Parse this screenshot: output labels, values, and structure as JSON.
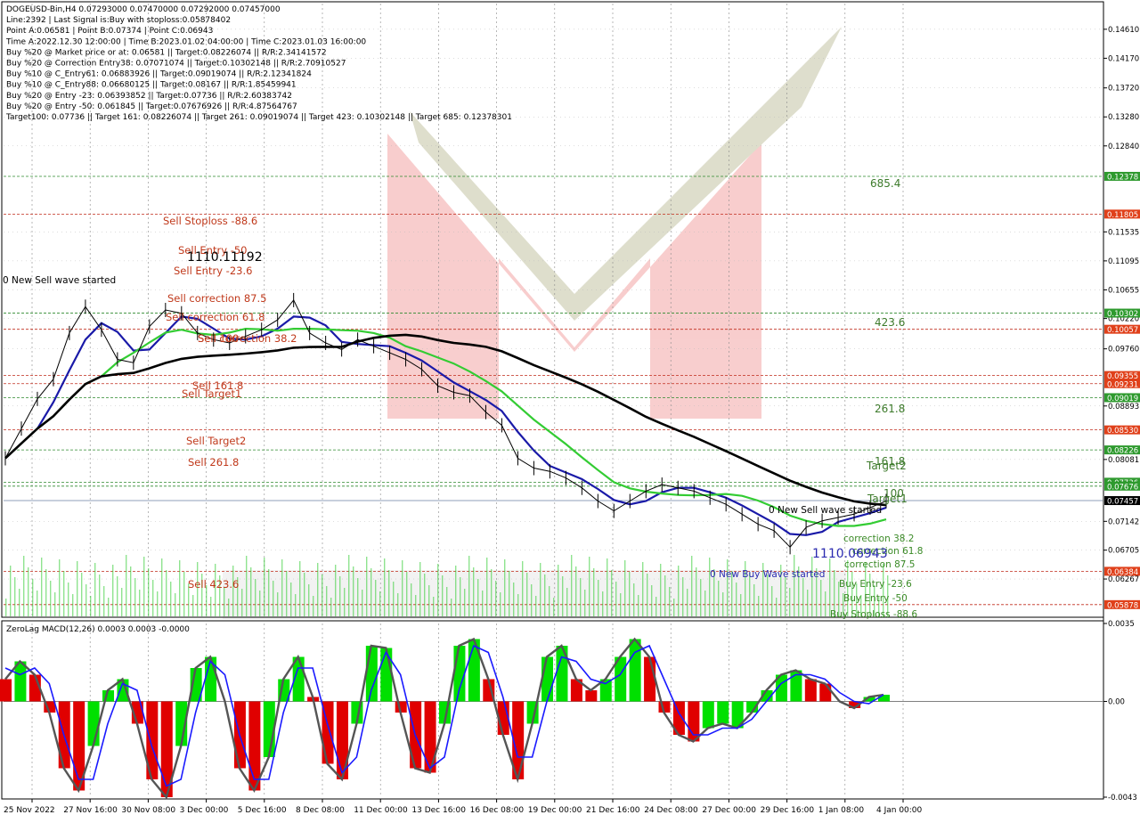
{
  "header_lines": [
    "DOGEUSD-Bin,H4  0.07293000 0.07470000 0.07292000 0.07457000",
    "Line:2392 | Last Signal is:Buy with stoploss:0.05878402",
    "Point A:0.06581 | Point B:0.07374 | Point C:0.06943",
    "Time A:2022.12.30 12:00:00 | Time B:2023.01.02 04:00:00 | Time C:2023.01.03 16:00:00",
    "Buy %20 @ Market price or at: 0.06581 || Target:0.08226074 || R/R:2.34141572",
    "Buy %20 @ Correction Entry38: 0.07071074 || Target:0.10302148 || R/R:2.70910527",
    "Buy %10 @ C_Entry61: 0.06883926 || Target:0.09019074 || R/R:2.12341824",
    "Buy %10 @ C_Entry88: 0.06680125 || Target:0.08167 || R/R:1.85459941",
    "Buy %20 @ Entry -23: 0.06393852 || Target:0.07736 || R/R:2.60383742",
    "Buy %20 @ Entry -50: 0.061845 || Target:0.07676926 || R/R:4.87564767",
    "Target100: 0.07736 || Target 161: 0.08226074 || Target 261: 0.09019074 || Target 423: 0.10302148 || Target 685: 0.12378301"
  ],
  "colors": {
    "sell": "#c0391b",
    "buy": "#3a8a26",
    "blue": "#1a1aa8",
    "green_ma": "#33cc33",
    "black_ma": "#000000",
    "macd_green": "#00e000",
    "macd_red": "#e00000",
    "price_tag_green": "#2e9a2e",
    "price_tag_red": "#e0401a",
    "price_tag_current": "#000000"
  },
  "sell_labels": [
    "Sell Stoploss -88.6",
    "Sell Entry -50",
    "Sell Entry -23.6",
    "Sell correction 87.5",
    "Sell correction 61.8",
    "Sell correction 38.2",
    "Sell 100",
    "Sell 161.8",
    "Sell Target1",
    "Sell Target2",
    "Sell  261.8",
    "Sell  423.6"
  ],
  "buy_labels": [
    "685.4",
    "423.6",
    "261.8",
    "161.8",
    "Target2",
    "100",
    "Target1",
    "correction 38.2",
    "correction 61.8",
    "correction 87.5",
    "Buy Entry -23.6",
    "Buy Entry -50",
    "Buy Stoploss -88.6"
  ],
  "wave_labels": [
    "0 New Sell wave started",
    "0 New Sell wave started",
    "0 New Buy Wave started"
  ],
  "point_labels": [
    "1110.11192",
    "1110.06943"
  ],
  "macd_title": "ZeroLag MACD(12,26) 0.0003 0.0003 -0.0000",
  "price_tags": [
    {
      "v": 0.12378,
      "label": "0.12378",
      "type": "green"
    },
    {
      "v": 0.11805,
      "label": "0.11805",
      "type": "red"
    },
    {
      "v": 0.10302,
      "label": "0.10302",
      "type": "green"
    },
    {
      "v": 0.10057,
      "label": "0.10057",
      "type": "red"
    },
    {
      "v": 0.09355,
      "label": "0.09355",
      "type": "red"
    },
    {
      "v": 0.09231,
      "label": "0.09231",
      "type": "red"
    },
    {
      "v": 0.09019,
      "label": "0.09019",
      "type": "green"
    },
    {
      "v": 0.0853,
      "label": "0.08530",
      "type": "red"
    },
    {
      "v": 0.08226,
      "label": "0.08226",
      "type": "green"
    },
    {
      "v": 0.07736,
      "label": "0.07736",
      "type": "green"
    },
    {
      "v": 0.07676,
      "label": "0.07676",
      "type": "green"
    },
    {
      "v": 0.07457,
      "label": "0.07457",
      "type": "current"
    },
    {
      "v": 0.06384,
      "label": "0.06384",
      "type": "red"
    },
    {
      "v": 0.05878,
      "label": "0.05878",
      "type": "red"
    }
  ],
  "chart_data": {
    "type": "line",
    "symbol": "DOGEUSD-Bin",
    "timeframe": "H4",
    "ohlc_current": {
      "open": 0.07293,
      "high": 0.0747,
      "low": 0.07292,
      "close": 0.07457
    },
    "x_ticks": [
      "25 Nov 2022",
      "27 Nov 16:00",
      "30 Nov 08:00",
      "3 Dec 00:00",
      "5 Dec 16:00",
      "8 Dec 08:00",
      "11 Dec 00:00",
      "13 Dec 16:00",
      "16 Dec 08:00",
      "19 Dec 00:00",
      "21 Dec 16:00",
      "24 Dec 08:00",
      "27 Dec 00:00",
      "29 Dec 16:00",
      "1 Jan 08:00",
      "4 Jan 00:00"
    ],
    "y_ticks": [
      0.1461,
      0.1417,
      0.1372,
      0.1328,
      0.1284,
      0.11535,
      0.11095,
      0.10655,
      0.1022,
      0.0976,
      0.08893,
      0.08081,
      0.07142,
      0.06705,
      0.06267
    ],
    "y_tick_labels": [
      "0.14610",
      "0.14170",
      "0.13720",
      "0.13280",
      "0.12840",
      "0.11535",
      "0.11095",
      "0.10655",
      "0.10220",
      "0.09760",
      "0.08893",
      "0.08081",
      "0.07142",
      "0.06705",
      "0.06267"
    ],
    "ylim": [
      0.057,
      0.15
    ],
    "levels": [
      {
        "name": "685.4",
        "value": 0.12378,
        "side": "buy"
      },
      {
        "name": "Sell Stoploss -88.6",
        "value": 0.11805,
        "side": "sell"
      },
      {
        "name": "423.6",
        "value": 0.10302,
        "side": "buy"
      },
      {
        "name": "Sell Entry -50",
        "value": 0.10057,
        "side": "sell"
      },
      {
        "name": "Sell 161.8",
        "value": 0.09355,
        "side": "sell"
      },
      {
        "name": "Sell Target1",
        "value": 0.09231,
        "side": "sell"
      },
      {
        "name": "261.8",
        "value": 0.09019,
        "side": "buy"
      },
      {
        "name": "Sell Target2",
        "value": 0.0853,
        "side": "sell"
      },
      {
        "name": "161.8",
        "value": 0.08226,
        "side": "buy"
      },
      {
        "name": "100",
        "value": 0.07736,
        "side": "buy"
      },
      {
        "name": "Target1",
        "value": 0.07676,
        "side": "buy"
      },
      {
        "name": "Buy Entry -23.6",
        "value": 0.06384,
        "side": "sell"
      },
      {
        "name": "Buy Stoploss -88.6",
        "value": 0.05878,
        "side": "sell"
      }
    ],
    "close_series": [
      0.081,
      0.0855,
      0.09,
      0.093,
      0.1,
      0.104,
      0.1005,
      0.096,
      0.0955,
      0.101,
      0.1035,
      0.103,
      0.1,
      0.099,
      0.0985,
      0.0995,
      0.1005,
      0.102,
      0.105,
      0.1,
      0.0985,
      0.0975,
      0.099,
      0.098,
      0.097,
      0.096,
      0.0945,
      0.092,
      0.091,
      0.0905,
      0.088,
      0.086,
      0.081,
      0.0795,
      0.079,
      0.078,
      0.0765,
      0.0745,
      0.073,
      0.0745,
      0.076,
      0.077,
      0.0765,
      0.076,
      0.075,
      0.074,
      0.0725,
      0.071,
      0.07,
      0.0675,
      0.0705,
      0.0715,
      0.072,
      0.0725,
      0.0735,
      0.0745
    ],
    "macd": {
      "ylim": [
        -0.0043,
        0.0035
      ],
      "y_ticks": [
        0.0035,
        0.0,
        -0.0043
      ],
      "y_tick_labels": [
        "0.0035",
        "0.00",
        "-0.0043"
      ],
      "main": [
        0.001,
        0.0018,
        0.0012,
        -0.0005,
        -0.003,
        -0.004,
        -0.002,
        0.0005,
        0.001,
        -0.001,
        -0.0035,
        -0.0043,
        -0.002,
        0.0015,
        0.002,
        0.0,
        -0.003,
        -0.004,
        -0.0025,
        0.001,
        0.002,
        0.0002,
        -0.0028,
        -0.0035,
        -0.001,
        0.0025,
        0.0024,
        -0.0005,
        -0.003,
        -0.0032,
        -0.001,
        0.0025,
        0.0028,
        0.001,
        -0.0015,
        -0.0035,
        -0.001,
        0.002,
        0.0025,
        0.001,
        0.0005,
        0.001,
        0.002,
        0.0028,
        0.002,
        -0.0005,
        -0.0015,
        -0.0018,
        -0.0012,
        -0.001,
        -0.0012,
        -0.0005,
        0.0005,
        0.0012,
        0.0014,
        0.001,
        0.0008,
        0.0,
        -0.0003,
        0.0002,
        0.0003
      ],
      "signal": [
        0.0015,
        0.0012,
        0.0015,
        0.0008,
        -0.0015,
        -0.0035,
        -0.0035,
        -0.001,
        0.0008,
        0.0005,
        -0.002,
        -0.0038,
        -0.0035,
        -0.0005,
        0.0018,
        0.0012,
        -0.0015,
        -0.0035,
        -0.0035,
        -0.0005,
        0.0015,
        0.0015,
        -0.001,
        -0.0032,
        -0.0025,
        0.0005,
        0.0022,
        0.0012,
        -0.0015,
        -0.003,
        -0.0025,
        0.0005,
        0.0025,
        0.0022,
        0.0002,
        -0.0025,
        -0.0025,
        0.0,
        0.002,
        0.0018,
        0.001,
        0.0008,
        0.0012,
        0.0022,
        0.0025,
        0.001,
        -0.0005,
        -0.0015,
        -0.0015,
        -0.0012,
        -0.0012,
        -0.0008,
        0.0,
        0.0008,
        0.0012,
        0.0012,
        0.001,
        0.0004,
        0.0,
        -0.0001,
        0.0003
      ]
    }
  }
}
